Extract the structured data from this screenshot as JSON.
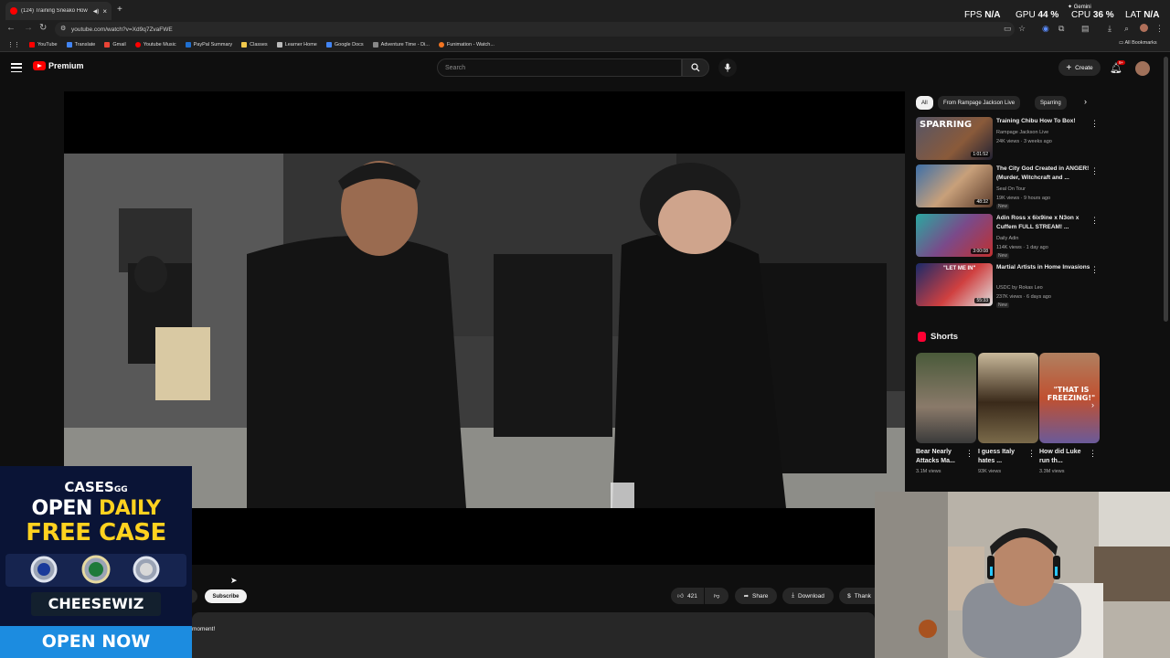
{
  "browser": {
    "tab_title": "(124) Training Sneako How",
    "url": "youtube.com/watch?v=Xd9q7ZvaFWE",
    "stats": {
      "fps_label": "FPS",
      "fps_value": "N/A",
      "gpu_label": "GPU",
      "gpu_value": "44 %",
      "cpu_label": "CPU",
      "cpu_value": "36 %",
      "lat_label": "LAT",
      "lat_value": "N/A",
      "gemini": "Gemini"
    },
    "bookmarks": [
      {
        "label": "YouTube",
        "color": "#ff0000"
      },
      {
        "label": "Translate",
        "color": "#4285f4"
      },
      {
        "label": "Gmail",
        "color": "#ea4335"
      },
      {
        "label": "Youtube Music",
        "color": "#ff0000"
      },
      {
        "label": "PayPal Summary",
        "color": "#1f6fd0"
      },
      {
        "label": "Classes",
        "color": "#f2c94c"
      },
      {
        "label": "Learner Home",
        "color": "#bbbbbb"
      },
      {
        "label": "Google Docs",
        "color": "#4285f4"
      },
      {
        "label": "Adventure Time - Di...",
        "color": "#888888"
      },
      {
        "label": "Funimation - Watch...",
        "color": "#f47521"
      }
    ],
    "all_bookmarks": "All Bookmarks"
  },
  "youtube": {
    "logo_text": "Premium",
    "search_placeholder": "Search",
    "create_label": "Create",
    "notif_badge": "9+",
    "chips": [
      "All",
      "From Rampage Jackson Live",
      "Sparring"
    ],
    "recommendations": [
      {
        "title": "Training Chibu How To Box!",
        "channel": "Rampage Jackson Live",
        "meta": "24K views · 3 weeks ago",
        "duration": "1:01:52",
        "new": ""
      },
      {
        "title": "The City God Created in ANGER! (Murder, Witchcraft and ...",
        "channel": "Seal On Tour",
        "meta": "19K views · 9 hours ago",
        "duration": "48:32",
        "new": "New"
      },
      {
        "title": "Adin Ross x 6ix9ine x N3on x Cuffem FULL STREAM! ...",
        "channel": "Daily Adin",
        "meta": "114K views · 1 day ago",
        "duration": "3:00:08",
        "new": "New"
      },
      {
        "title": "Martial Artists in Home Invasions",
        "channel": "USDC by Rokas Leo",
        "meta": "237K views · 6 days ago",
        "duration": "55:33",
        "new": "New"
      }
    ],
    "thumb_labels": [
      "SPARRING",
      "\"LET ME IN\""
    ],
    "shorts_title": "Shorts",
    "shorts": [
      {
        "title": "Bear Nearly Attacks Ma...",
        "views": "3.1M views"
      },
      {
        "title": "I guess Italy hates ...",
        "views": "93K views"
      },
      {
        "title": "How did Luke run th...",
        "views": "3.3M views"
      }
    ],
    "short_overlay": "\"THAT IS FREEZING!\"",
    "subscribe_label": "Subscribe",
    "like_count": "421",
    "share_label": "Share",
    "download_label": "Download",
    "thanks_label": "Thank",
    "description_fragment": "moment!"
  },
  "ad": {
    "brand": "CASES",
    "brand_suffix": "GG",
    "line1_a": "OPEN",
    "line1_b": "DAILY",
    "line2": "FREE CASE",
    "code": "CHEESEWIZ",
    "cta": "OPEN NOW"
  },
  "colors": {
    "accent": "#ff0000",
    "ad_bg": "#0a1436",
    "ad_yellow": "#ffd21f",
    "ad_button": "#1c8ce0"
  }
}
